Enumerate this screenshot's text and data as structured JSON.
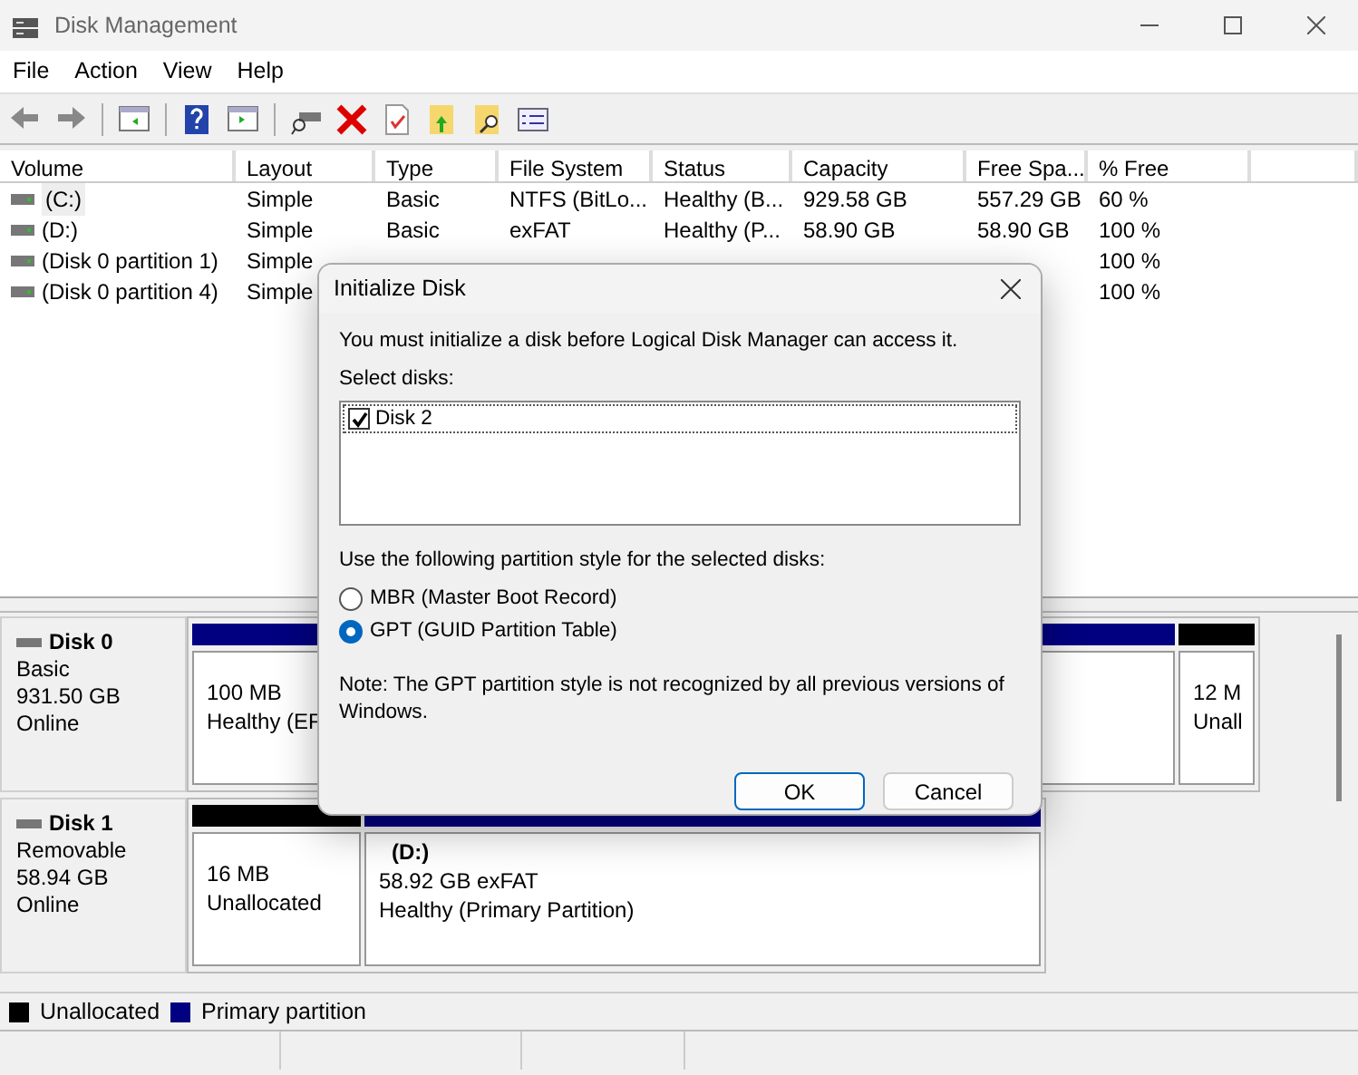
{
  "window": {
    "title": "Disk Management"
  },
  "menu": [
    "File",
    "Action",
    "View",
    "Help"
  ],
  "toolbar": [
    {
      "kind": "back"
    },
    {
      "kind": "forward"
    },
    {
      "kind": "separator"
    },
    {
      "kind": "tree"
    },
    {
      "kind": "separator"
    },
    {
      "kind": "help"
    },
    {
      "kind": "panel"
    },
    {
      "kind": "separator"
    },
    {
      "kind": "connect"
    },
    {
      "kind": "delete"
    },
    {
      "kind": "check"
    },
    {
      "kind": "folder-up"
    },
    {
      "kind": "folder-search"
    },
    {
      "kind": "list"
    }
  ],
  "volume_table": {
    "columns": [
      "Volume",
      "Layout",
      "Type",
      "File System",
      "Status",
      "Capacity",
      "Free Spa...",
      "% Free"
    ],
    "rows": [
      {
        "volume": "(C:)",
        "layout": "Simple",
        "type": "Basic",
        "file_system": "NTFS (BitLo...",
        "status": "Healthy (B...",
        "capacity": "929.58 GB",
        "free_space": "557.29 GB",
        "percent_free": "60 %",
        "selected": true
      },
      {
        "volume": "(D:)",
        "layout": "Simple",
        "type": "Basic",
        "file_system": "exFAT",
        "status": "Healthy (P...",
        "capacity": "58.90 GB",
        "free_space": "58.90 GB",
        "percent_free": "100 %",
        "selected": false
      },
      {
        "volume": "(Disk 0 partition 1)",
        "layout": "Simple",
        "percent_free": "100 %",
        "selected": false
      },
      {
        "volume": "(Disk 0 partition 4)",
        "layout": "Simple",
        "percent_free": "100 %",
        "selected": false
      }
    ]
  },
  "disks": [
    {
      "name": "Disk 0",
      "type": "Basic",
      "size": "931.50 GB",
      "state": "Online",
      "partitions": [
        {
          "kind": "primary",
          "lines": [
            "100 MB",
            "Healthy (EF"
          ]
        },
        {
          "kind": "primary"
        },
        {
          "kind": "unallocated",
          "lines": [
            "12 M",
            "Unall"
          ]
        }
      ]
    },
    {
      "name": "Disk 1",
      "type": "Removable",
      "size": "58.94 GB",
      "state": "Online",
      "partitions": [
        {
          "kind": "unallocated",
          "lines": [
            "16 MB",
            "Unallocated"
          ]
        },
        {
          "kind": "primary",
          "title": "(D:)",
          "lines": [
            "58.92 GB exFAT",
            "Healthy (Primary Partition)"
          ]
        }
      ]
    }
  ],
  "legend": [
    {
      "label": "Unallocated",
      "color": "#000000"
    },
    {
      "label": "Primary partition",
      "color": "#000080"
    }
  ],
  "dialog": {
    "title": "Initialize Disk",
    "message": "You must initialize a disk before Logical Disk Manager can access it.",
    "select_label": "Select disks:",
    "disks": [
      {
        "label": "Disk 2",
        "checked": true
      }
    ],
    "style_label": "Use the following partition style for the selected disks:",
    "styles": [
      {
        "label": "MBR (Master Boot Record)",
        "selected": false
      },
      {
        "label": "GPT (GUID Partition Table)",
        "selected": true
      }
    ],
    "note": "Note: The GPT partition style is not recognized by all previous versions of Windows.",
    "buttons": [
      {
        "label": "OK",
        "default": true
      },
      {
        "label": "Cancel",
        "default": false
      }
    ]
  }
}
